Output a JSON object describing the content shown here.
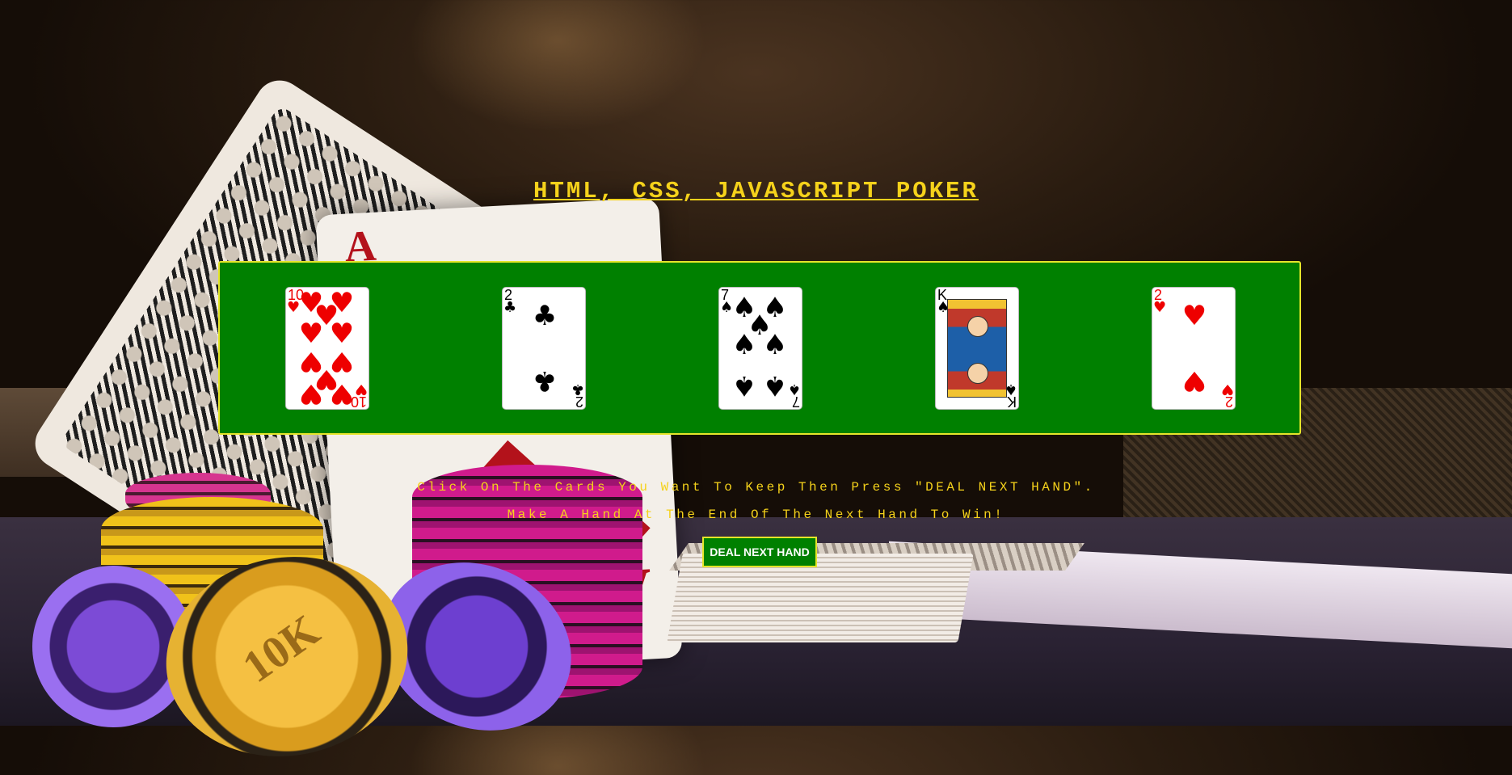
{
  "page": {
    "title": "HTML, CSS, JAVASCRIPT POKER",
    "accent_color": "#f5d21b",
    "panel_color": "#008000"
  },
  "hand": {
    "cards": [
      {
        "rank": "10",
        "suit": "hearts",
        "suit_symbol": "♥",
        "color": "red"
      },
      {
        "rank": "2",
        "suit": "clubs",
        "suit_symbol": "♣",
        "color": "black"
      },
      {
        "rank": "7",
        "suit": "spades",
        "suit_symbol": "♠",
        "color": "black"
      },
      {
        "rank": "K",
        "suit": "spades",
        "suit_symbol": "♠",
        "color": "black"
      },
      {
        "rank": "2",
        "suit": "hearts",
        "suit_symbol": "♥",
        "color": "red"
      }
    ]
  },
  "instructions": {
    "line1": "Click On The Cards You Want To Keep Then Press \"DEAL NEXT HAND\".",
    "line2": "Make A Hand At The End Of The Next Hand To Win!"
  },
  "controls": {
    "deal_label": "DEAL NEXT HAND"
  },
  "background": {
    "chip_label": "10K",
    "ace_rank": "A"
  }
}
